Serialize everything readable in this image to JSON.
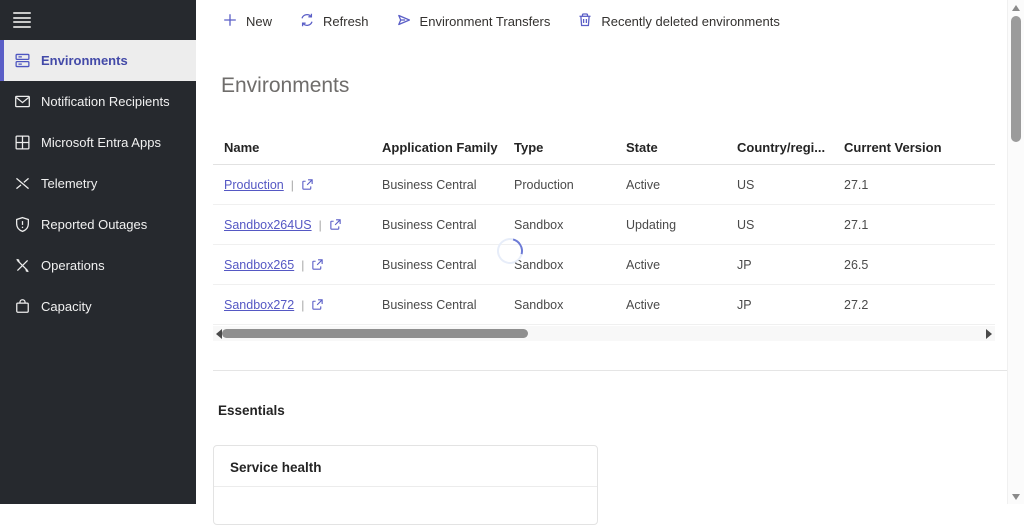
{
  "colors": {
    "accent": "#5b5fc7",
    "sidebar_bg": "#26292e",
    "selected_text": "#434aa8"
  },
  "sidebar": {
    "items": [
      {
        "label": "Environments",
        "selected": true
      },
      {
        "label": "Notification Recipients",
        "selected": false
      },
      {
        "label": "Microsoft Entra Apps",
        "selected": false
      },
      {
        "label": "Telemetry",
        "selected": false
      },
      {
        "label": "Reported Outages",
        "selected": false
      },
      {
        "label": "Operations",
        "selected": false
      },
      {
        "label": "Capacity",
        "selected": false
      }
    ]
  },
  "toolbar": {
    "actions": [
      {
        "label": "New",
        "icon": "plus-icon"
      },
      {
        "label": "Refresh",
        "icon": "refresh-icon"
      },
      {
        "label": "Environment Transfers",
        "icon": "transfer-icon"
      },
      {
        "label": "Recently deleted environments",
        "icon": "deleted-bin-icon"
      }
    ]
  },
  "page": {
    "title": "Environments"
  },
  "table": {
    "columns": [
      "Name",
      "Application Family",
      "Type",
      "State",
      "Country/regi...",
      "Current Version"
    ],
    "name_separator": "|",
    "rows": [
      {
        "name": "Production",
        "application_family": "Business Central",
        "type": "Production",
        "state": "Active",
        "country": "US",
        "current_version": "27.1"
      },
      {
        "name": "Sandbox264US",
        "application_family": "Business Central",
        "type": "Sandbox",
        "state": "Updating",
        "country": "US",
        "current_version": "27.1"
      },
      {
        "name": "Sandbox265",
        "application_family": "Business Central",
        "type": "Sandbox",
        "state": "Active",
        "country": "JP",
        "current_version": "26.5"
      },
      {
        "name": "Sandbox272",
        "application_family": "Business Central",
        "type": "Sandbox",
        "state": "Active",
        "country": "JP",
        "current_version": "27.2"
      }
    ]
  },
  "essentials": {
    "heading": "Essentials",
    "card_title": "Service health"
  }
}
